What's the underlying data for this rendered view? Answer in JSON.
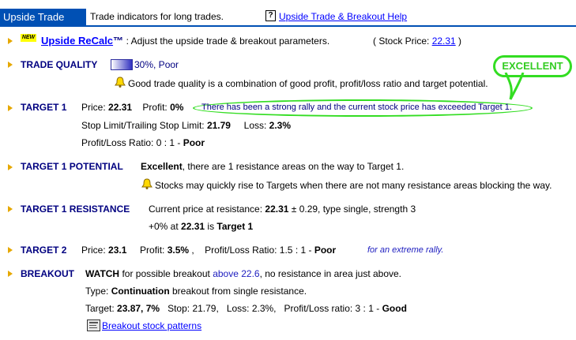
{
  "header": {
    "tab_label": "Upside Trade",
    "description": "Trade indicators for long trades.",
    "help_link": "Upside Trade & Breakout Help",
    "help_icon": "?"
  },
  "recalc": {
    "badge": "NEW",
    "link": "Upside ReCalc",
    "tm": "™",
    "desc": ": Adjust the upside trade & breakout parameters.",
    "stock_price_prefix": "( Stock Price: ",
    "stock_price": "22.31",
    "stock_price_suffix": " )"
  },
  "trade_quality": {
    "title": "TRADE QUALITY",
    "value": "30%, Poor",
    "level_pct": 30,
    "note": "Good trade quality is a combination of good profit, profit/loss ratio and target potential."
  },
  "target1": {
    "title": "TARGET 1",
    "price_label": "Price: ",
    "price": "22.31",
    "profit_label": "Profit: ",
    "profit": "0%",
    "note": "There has been a strong rally and the current stock price has exceeded Target 1.",
    "stop_label": "Stop Limit/Trailing Stop Limit: ",
    "stop": "21.79",
    "loss_label": "Loss: ",
    "loss": "2.3%",
    "ratio_label": "Profit/Loss Ratio: 0 : 1 - ",
    "ratio_rating": "Poor"
  },
  "annotation": {
    "label": "EXCELLENT"
  },
  "target1_potential": {
    "title": "TARGET 1 POTENTIAL",
    "rating": "Excellent",
    "text": ", there are 1 resistance areas on the way to Target 1.",
    "note": "Stocks may quickly rise to Targets when there are not many resistance areas blocking the way."
  },
  "target1_resistance": {
    "title": "TARGET 1 RESISTANCE",
    "line1_prefix": "Current price at resistance: ",
    "price": "22.31",
    "line1_suffix": " ± 0.29, type single, strength 3",
    "line2_prefix": "+0% at ",
    "line2_price": "22.31",
    "line2_mid": " is ",
    "line2_target": "Target 1"
  },
  "target2": {
    "title": "TARGET 2",
    "price_label": "Price: ",
    "price": "23.1",
    "profit_label": "Profit: ",
    "profit": "3.5%",
    "ratio_label": " ,    Profit/Loss Ratio: 1.5 : 1 - ",
    "ratio_rating": "Poor",
    "note": "for an extreme rally."
  },
  "breakout": {
    "title": "BREAKOUT",
    "watch": "WATCH",
    "watch_text": " for possible breakout ",
    "above": "above 22.6",
    "rest": ", no resistance in area just above.",
    "type_label": "Type: ",
    "type_value": "Continuation",
    "type_rest": " breakout from single resistance.",
    "target_label": "Target: ",
    "target_value": "23.87, 7%",
    "stop_text": "Stop: 21.79,   Loss: 2.3%,   Profit/Loss ratio: 3 : 1 - ",
    "rating": "Good",
    "patterns_link": "Breakout stock patterns"
  },
  "colors": {
    "accent": "#0050b4",
    "annotation": "#33dd22",
    "arrow": "#e6a800"
  }
}
